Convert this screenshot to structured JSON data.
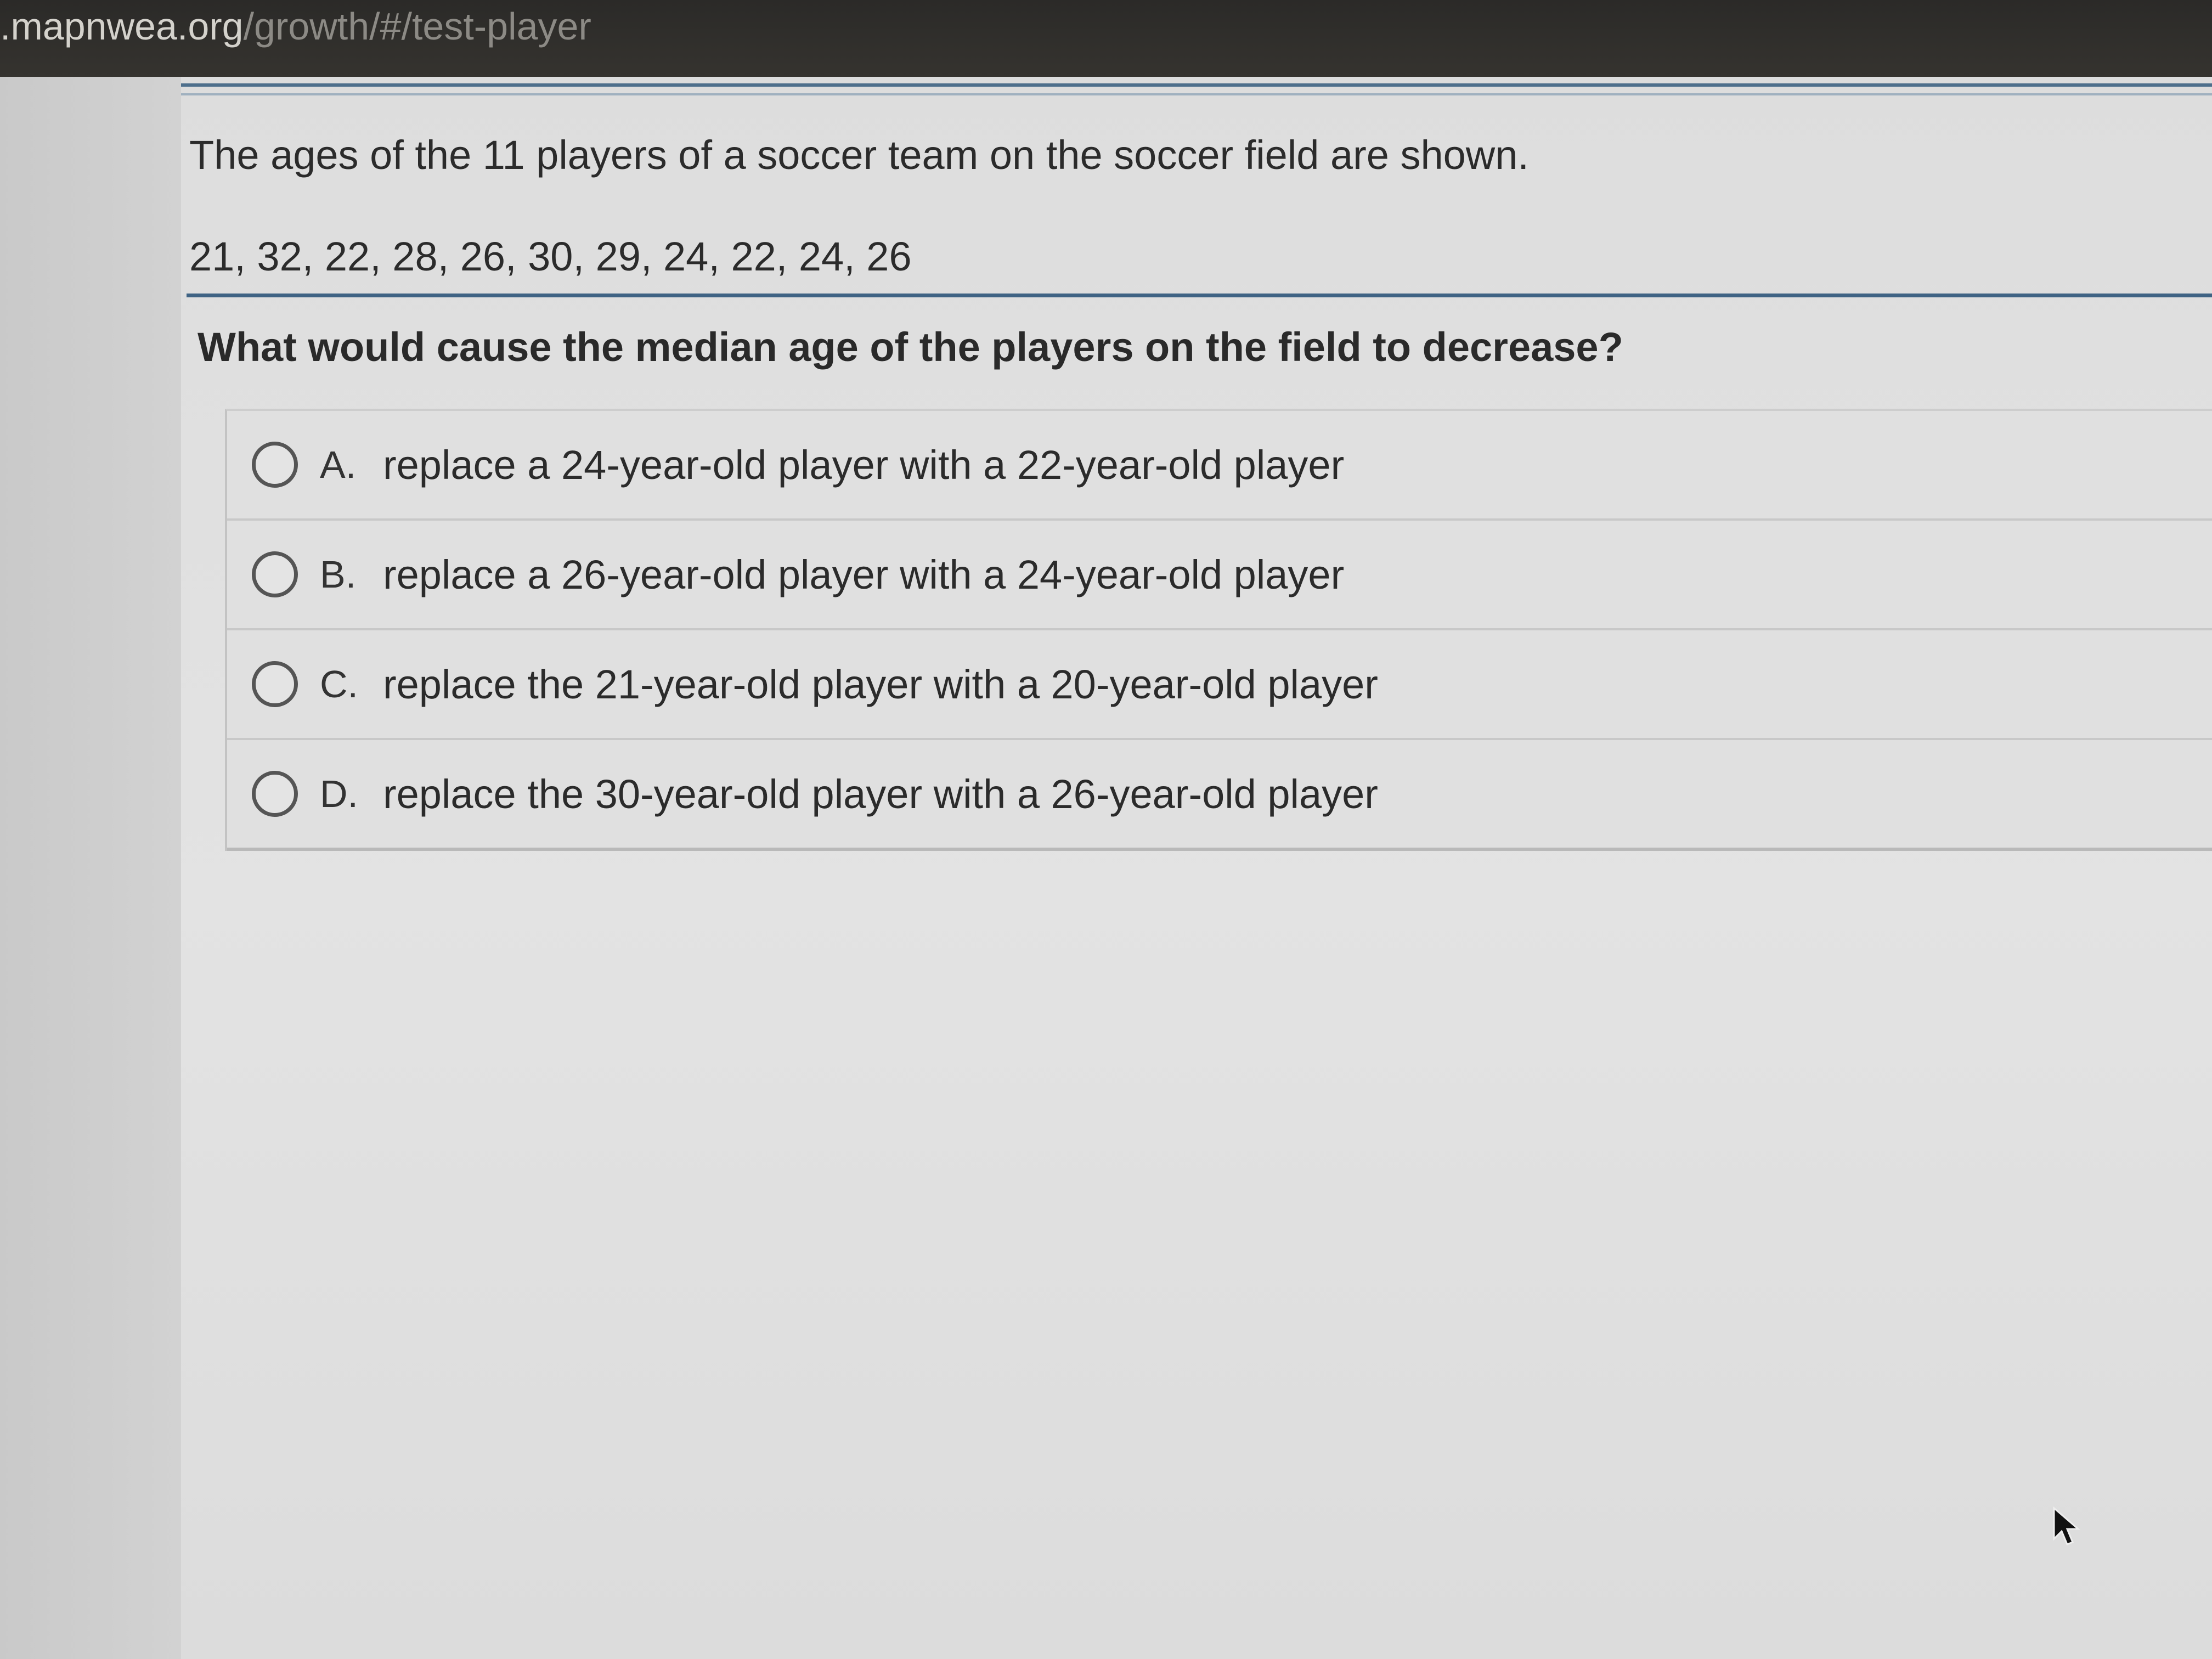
{
  "browser": {
    "url_host": ".mapnwea.org",
    "url_path": "/growth/#/test-player"
  },
  "question": {
    "stem": "The ages of the 11 players of a soccer team on the soccer field are shown.",
    "data": "21, 32, 22, 28, 26, 30, 29, 24, 22, 24, 26",
    "prompt": "What would cause the median age of the players on the field to decrease?"
  },
  "choices": [
    {
      "letter": "A.",
      "text": "replace a 24-year-old player with a 22-year-old player"
    },
    {
      "letter": "B.",
      "text": "replace a 26-year-old player with a 24-year-old player"
    },
    {
      "letter": "C.",
      "text": "replace the 21-year-old player with a 20-year-old player"
    },
    {
      "letter": "D.",
      "text": "replace the 30-year-old player with a 26-year-old player"
    }
  ],
  "icons": {
    "radio": "radio-button-icon",
    "cursor": "mouse-pointer-icon"
  },
  "colors": {
    "rule": "#3f6384",
    "browser_bar": "#2b2a28"
  }
}
